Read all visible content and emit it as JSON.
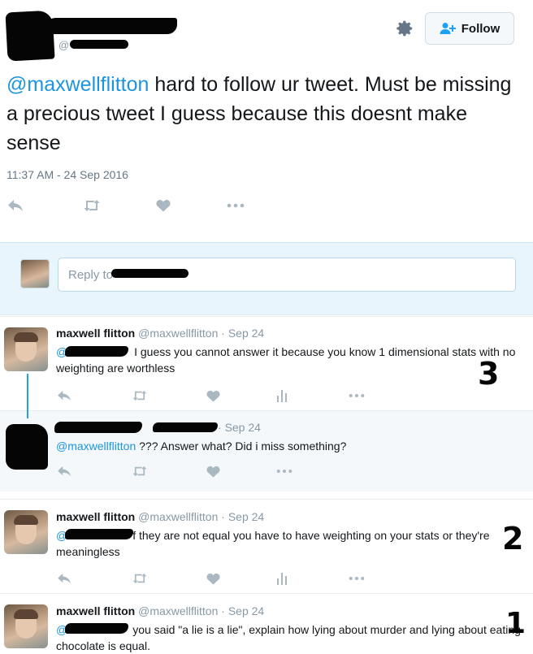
{
  "header": {
    "handle_prefix": "@",
    "follow_label": "Follow",
    "gear_icon": "gear-icon",
    "follow_icon": "add-user-icon"
  },
  "tweet": {
    "mention": "@maxwellflitton",
    "text": " hard to follow ur tweet. Must be missing a precious tweet I guess because this doesnt make sense",
    "timestamp": "11:37 AM - 24 Sep 2016",
    "actions": [
      "reply-icon",
      "retweet-icon",
      "like-icon",
      "more-icon"
    ]
  },
  "reply_box": {
    "placeholder": "Reply to "
  },
  "replies": [
    {
      "name": "maxwell flitton",
      "handle": "@maxwellflitton",
      "date": "Sep 24",
      "mention": "@",
      "text": " I guess you cannot answer it because you know 1 dimensional stats with no weighting are worthless",
      "annotation": "3"
    },
    {
      "date": "Sep 24",
      "mention": "@maxwellflitton",
      "text": " ??? Answer what? Did i miss something?"
    },
    {
      "name": "maxwell flitton",
      "handle": "@maxwellflitton",
      "date": "Sep 24",
      "mention": "@",
      "text": "f they are not equal you have to have weighting on your stats or they're meaningless",
      "annotation": "2"
    },
    {
      "name": "maxwell flitton",
      "handle": "@maxwellflitton",
      "date": "Sep 24",
      "mention": "@",
      "text": "you said \"a lie is a lie\", explain how lying about murder and lying about eating chocolate is equal.",
      "annotation": "1"
    }
  ],
  "colors": {
    "link": "#1b95e0",
    "muted": "#8899a6",
    "reply_bg": "#e8f5fd"
  }
}
